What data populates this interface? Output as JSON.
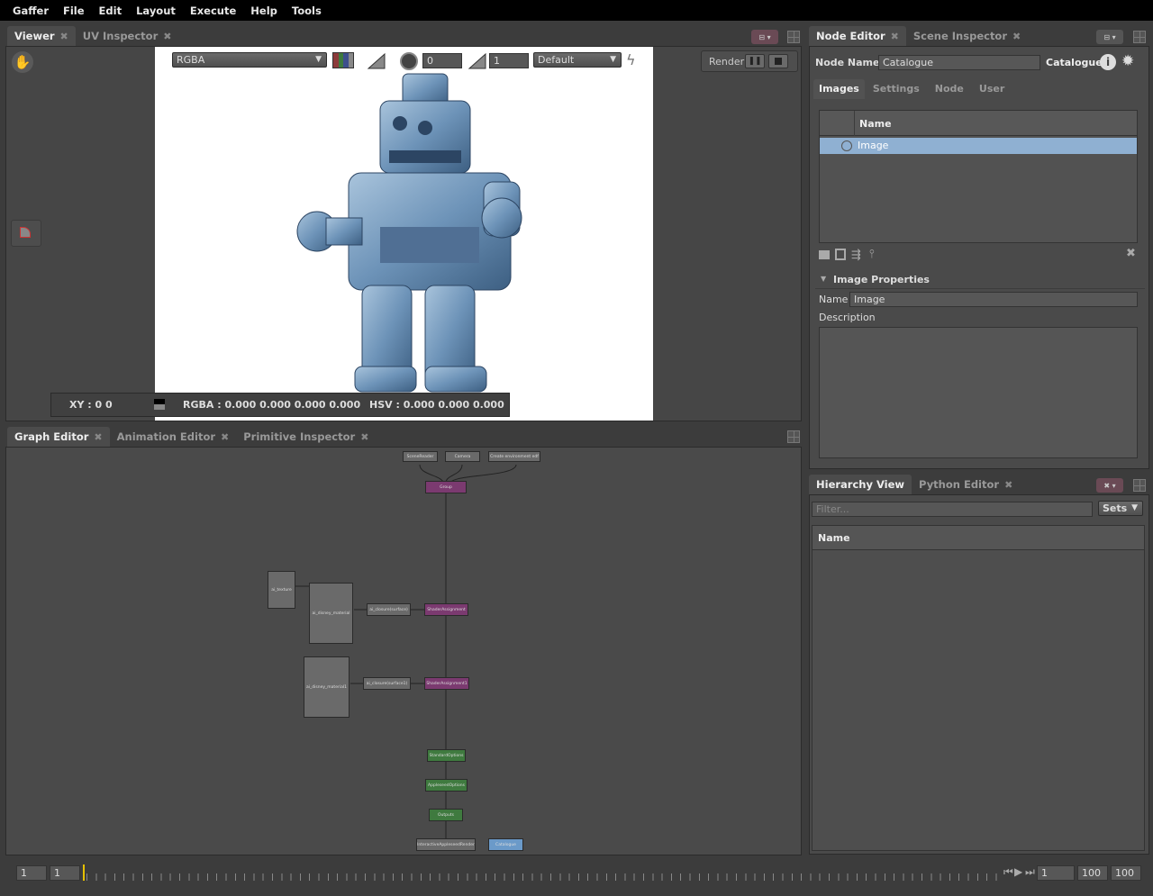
{
  "menu": [
    "Gaffer",
    "File",
    "Edit",
    "Layout",
    "Execute",
    "Help",
    "Tools"
  ],
  "viewer": {
    "tabs": [
      {
        "label": "Viewer",
        "active": true
      },
      {
        "label": "UV Inspector",
        "active": false
      }
    ],
    "channel": "RGBA",
    "exposure": "0",
    "gamma": "1",
    "display": "Default",
    "render_label": "Render",
    "status": {
      "xy": "XY : 0 0",
      "rgba": "RGBA : 0.000 0.000 0.000 0.000",
      "hsv": "HSV : 0.000 0.000 0.000"
    }
  },
  "graph": {
    "tabs": [
      {
        "label": "Graph Editor",
        "active": true
      },
      {
        "label": "Animation Editor",
        "active": false
      },
      {
        "label": "Primitive Inspector",
        "active": false
      }
    ],
    "nodes": [
      "SceneReader",
      "Camera",
      "Create environment edf",
      "Group",
      "ai_texture",
      "ai_disney_material",
      "ai_closure(surface)",
      "ShaderAssignment",
      "ai_disney_material1",
      "ai_closure(surface1)",
      "ShaderAssignment1",
      "StandardOptions",
      "AppleseedOptions",
      "Outputs",
      "InteractiveAppleseedRender",
      "Catalogue"
    ]
  },
  "node_editor": {
    "tabs": [
      {
        "label": "Node Editor",
        "active": true
      },
      {
        "label": "Scene Inspector",
        "active": false
      }
    ],
    "node_name_label": "Node Name",
    "node_name": "Catalogue",
    "node_type": "Catalogue",
    "subtabs": [
      "Images",
      "Settings",
      "Node",
      "User"
    ],
    "list_header": "Name",
    "list_items": [
      "Image"
    ],
    "section_title": "Image Properties",
    "name_label": "Name",
    "name_value": "Image",
    "description_label": "Description"
  },
  "hierarchy": {
    "tabs": [
      {
        "label": "Hierarchy View",
        "active": true
      },
      {
        "label": "Python Editor",
        "active": false
      }
    ],
    "filter_placeholder": "Filter...",
    "sets_label": "Sets",
    "column": "Name"
  },
  "timeline": {
    "start": "1",
    "current": "1",
    "frame": "1",
    "end_a": "100",
    "end_b": "100"
  }
}
